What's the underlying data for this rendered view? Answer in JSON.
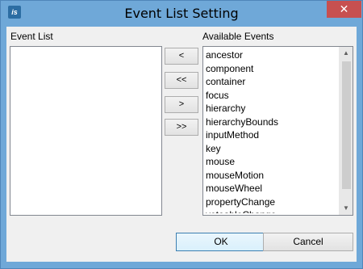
{
  "window": {
    "title": "Event List Setting",
    "app_icon_text": "is",
    "close_symbol": "✕"
  },
  "event_list": {
    "label": "Event List",
    "items": []
  },
  "buttons": {
    "add": "<",
    "add_all": "<<",
    "remove": ">",
    "remove_all": ">>"
  },
  "available_events": {
    "label": "Available Events",
    "items": [
      "ancestor",
      "component",
      "container",
      "focus",
      "hierarchy",
      "hierarchyBounds",
      "inputMethod",
      "key",
      "mouse",
      "mouseMotion",
      "mouseWheel",
      "propertyChange",
      "vetoableChange"
    ],
    "scrollbar": {
      "position": 0.0,
      "visible_fraction": 0.92
    }
  },
  "footer": {
    "ok_label": "OK",
    "cancel_label": "Cancel"
  },
  "icons": {
    "scroll_up": "chevron-up-icon",
    "scroll_down": "chevron-down-icon"
  }
}
